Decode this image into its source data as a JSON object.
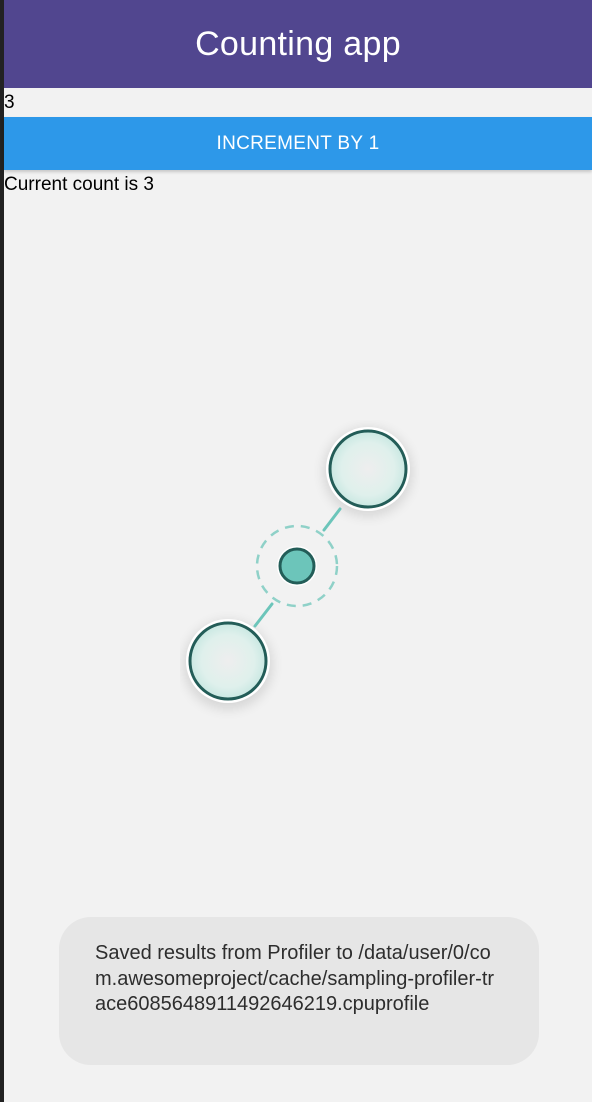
{
  "header": {
    "title": "Counting app",
    "background_color": "#51468f"
  },
  "counter": {
    "input_value": "3",
    "increment_button_label": "INCREMENT BY 1",
    "button_color": "#2d98e9",
    "status_text": "Current count is 3"
  },
  "gesture_overlay": {
    "icon": "pinch-zoom-gesture-icon",
    "accent_color": "#6cc5ba",
    "outline_color": "#235d58"
  },
  "toast": {
    "message": "Saved results from Profiler to /data/user/0/com.awesomeproject/cache/sampling-profiler-trace6085648911492646219.cpuprofile"
  }
}
